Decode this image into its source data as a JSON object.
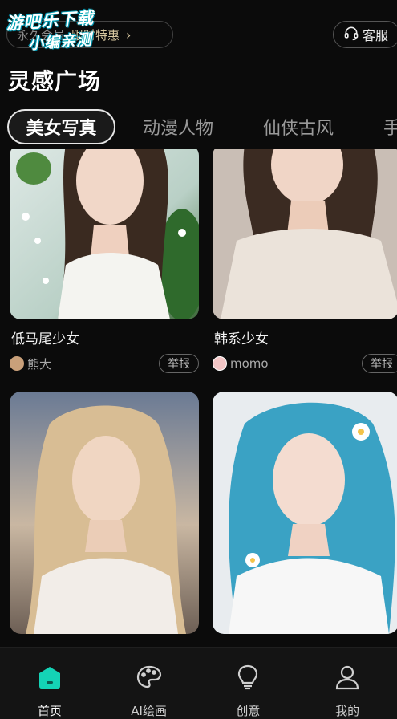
{
  "watermark": {
    "line1": "游吧乐下载",
    "line2": "小编亲测"
  },
  "promo": {
    "vip_text": "永久会员",
    "label": "限时特惠",
    "chevron": "›"
  },
  "service": {
    "icon": "headset-icon",
    "label": "客服"
  },
  "page_title": "灵感广场",
  "tabs": [
    "美女写真",
    "动漫人物",
    "仙侠古风",
    "手"
  ],
  "cards": [
    {
      "title": "低马尾少女",
      "author": "熊大",
      "report": "举报"
    },
    {
      "title": "韩系少女",
      "author": "momo",
      "report": "举报"
    },
    {
      "title": "",
      "author": "",
      "report": ""
    },
    {
      "title": "",
      "author": "",
      "report": ""
    }
  ],
  "nav": [
    {
      "label": "首页",
      "icon": "home-icon",
      "active": true
    },
    {
      "label": "AI绘画",
      "icon": "palette-icon",
      "active": false
    },
    {
      "label": "创意",
      "icon": "lightbulb-icon",
      "active": false
    },
    {
      "label": "我的",
      "icon": "user-icon",
      "active": false
    }
  ],
  "colors": {
    "accent": "#14d3b6",
    "background": "#0b0b0b",
    "promo_gold": "#d9c9a2"
  }
}
